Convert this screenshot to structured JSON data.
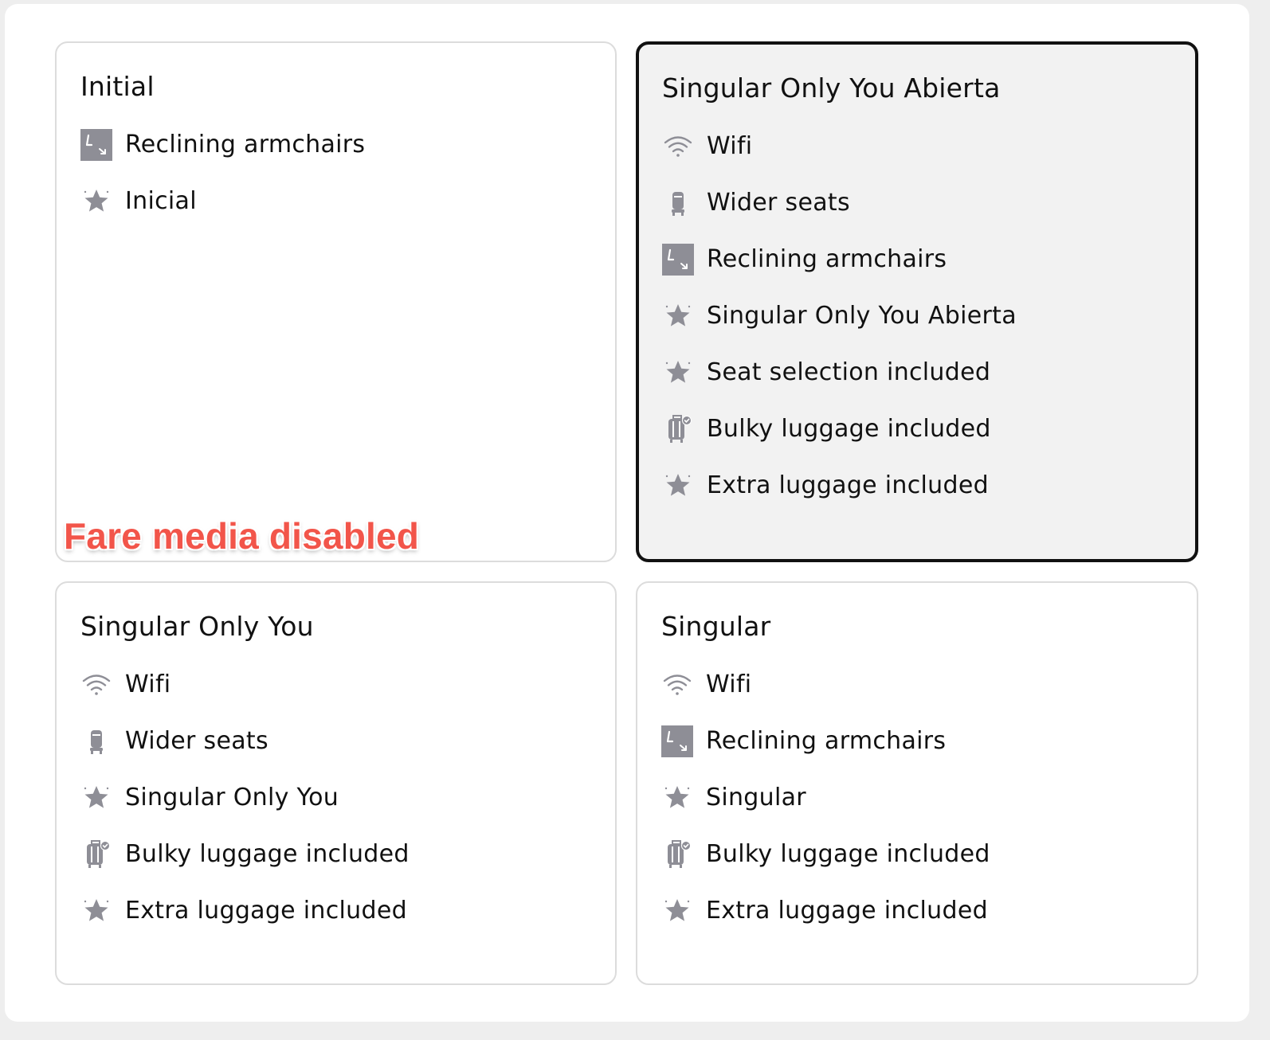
{
  "colors": {
    "icon": "#8e8e96",
    "note": "#f2554a",
    "selected_border": "#111111"
  },
  "cards": [
    {
      "title": "Initial",
      "selected": false,
      "features": [
        {
          "icon": "recline-icon",
          "label": "Reclining armchairs"
        },
        {
          "icon": "star-icon",
          "label": "Inicial"
        }
      ]
    },
    {
      "title": "Singular Only You Abierta",
      "selected": true,
      "features": [
        {
          "icon": "wifi-icon",
          "label": "Wifi"
        },
        {
          "icon": "seat-icon",
          "label": "Wider seats"
        },
        {
          "icon": "recline-icon",
          "label": "Reclining armchairs"
        },
        {
          "icon": "star-icon",
          "label": "Singular Only You Abierta"
        },
        {
          "icon": "star-icon",
          "label": "Seat selection included"
        },
        {
          "icon": "luggage-icon",
          "label": "Bulky luggage included"
        },
        {
          "icon": "star-icon",
          "label": "Extra luggage included"
        }
      ]
    },
    {
      "title": "Singular Only You",
      "selected": false,
      "features": [
        {
          "icon": "wifi-icon",
          "label": "Wifi"
        },
        {
          "icon": "seat-icon",
          "label": "Wider seats"
        },
        {
          "icon": "star-icon",
          "label": "Singular Only You"
        },
        {
          "icon": "luggage-icon",
          "label": "Bulky luggage included"
        },
        {
          "icon": "star-icon",
          "label": "Extra luggage included"
        }
      ]
    },
    {
      "title": "Singular",
      "selected": false,
      "features": [
        {
          "icon": "wifi-icon",
          "label": "Wifi"
        },
        {
          "icon": "recline-icon",
          "label": "Reclining armchairs"
        },
        {
          "icon": "star-icon",
          "label": "Singular"
        },
        {
          "icon": "luggage-icon",
          "label": "Bulky luggage included"
        },
        {
          "icon": "star-icon",
          "label": "Extra luggage included"
        }
      ]
    }
  ],
  "overlay_note": "Fare media disabled"
}
